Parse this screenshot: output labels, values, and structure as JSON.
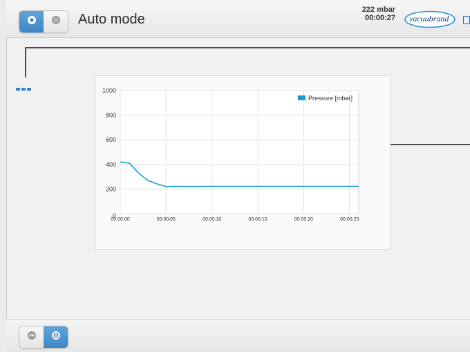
{
  "header": {
    "title": "Auto mode",
    "pressure": "222 mbar",
    "time": "00:00:27",
    "logo_text": "vacuubrand"
  },
  "mode_switch": {
    "items": [
      {
        "icon": "eye-icon",
        "active": true
      },
      {
        "icon": "settings-icon",
        "active": false
      }
    ]
  },
  "view_switch": {
    "items": [
      {
        "icon": "gauge-icon",
        "active": false
      },
      {
        "icon": "chart-icon",
        "active": true
      }
    ]
  },
  "chart_data": {
    "type": "line",
    "title": "",
    "xlabel": "",
    "ylabel": "",
    "ylim": [
      0,
      1000
    ],
    "xlim": [
      0,
      26
    ],
    "y_ticks": [
      "1000",
      "800",
      "600",
      "400",
      "200",
      "0"
    ],
    "x_ticks": [
      "00:00:00",
      "00:00:05",
      "00:00:10",
      "00:00:15",
      "00:00:20",
      "00:00:25"
    ],
    "grid": true,
    "legend_position": "top-right",
    "series": [
      {
        "name": "Pressure [mbar]",
        "color": "#1a9ad6",
        "x": [
          0,
          1,
          2,
          3,
          4,
          5,
          6,
          8,
          10,
          15,
          20,
          25,
          26
        ],
        "y": [
          420,
          410,
          330,
          270,
          242,
          220,
          222,
          221,
          222,
          222,
          222,
          222,
          222
        ]
      }
    ]
  },
  "colors": {
    "accent": "#3f86c4",
    "series": "#1a9ad6"
  }
}
